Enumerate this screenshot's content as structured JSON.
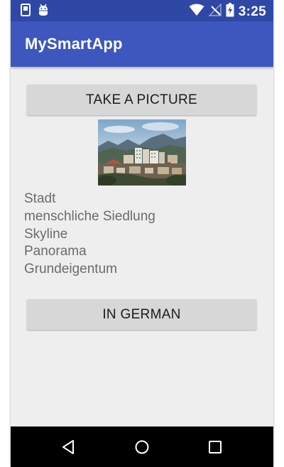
{
  "status_bar": {
    "time": "3:25",
    "icons": [
      "notification-square-icon",
      "android-debug-icon",
      "wifi-icon",
      "no-signal-icon",
      "battery-charging-icon"
    ]
  },
  "app_bar": {
    "title": "MySmartApp"
  },
  "main": {
    "take_picture_label": "TAKE A PICTURE",
    "image": {
      "description": "city-skyline-photo"
    },
    "labels": [
      "Stadt",
      "menschliche Siedlung",
      "Skyline",
      "Panorama",
      "Grundeigentum"
    ],
    "translate_label": "IN GERMAN"
  },
  "nav_bar": {
    "icons": [
      "back-icon",
      "home-icon",
      "recents-icon"
    ]
  },
  "colors": {
    "status_bar": "#2f48a6",
    "app_bar": "#3d57bf",
    "background": "#eeeeee",
    "button": "#d7d7d7",
    "label_text": "#6b6b6b"
  }
}
